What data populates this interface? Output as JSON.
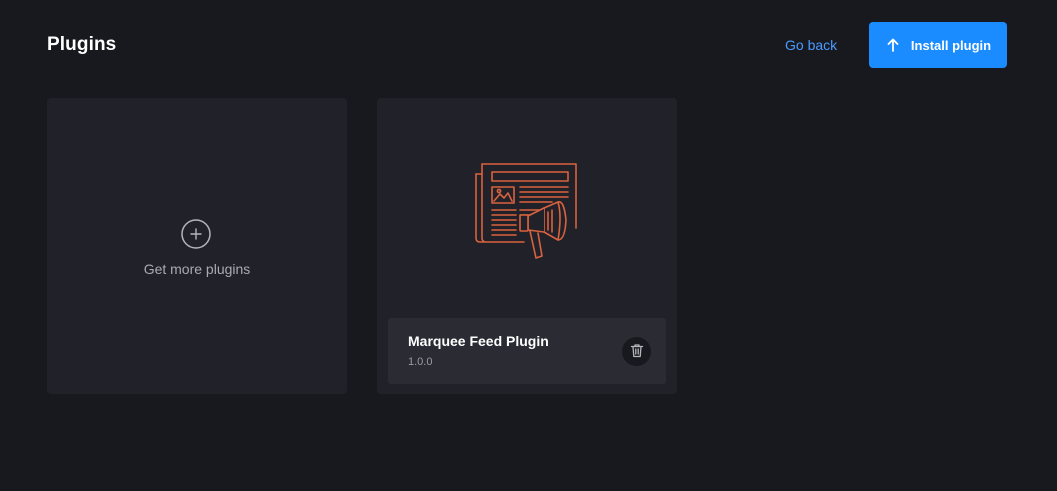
{
  "header": {
    "title": "Plugins",
    "go_back_label": "Go back",
    "install_label": "Install plugin",
    "install_icon": "arrow-up-icon"
  },
  "cards": {
    "get_more": {
      "label": "Get more plugins",
      "icon": "plus-circle-icon"
    },
    "plugin": {
      "name": "Marquee Feed Plugin",
      "version": "1.0.0",
      "illustration": "newspaper-megaphone-icon",
      "delete_icon": "trash-icon"
    }
  },
  "colors": {
    "background": "#18191e",
    "card": "#212229",
    "footer": "#2a2b33",
    "accent": "#1a8cff",
    "link": "#4a9bff",
    "illustration": "#d9623f"
  }
}
